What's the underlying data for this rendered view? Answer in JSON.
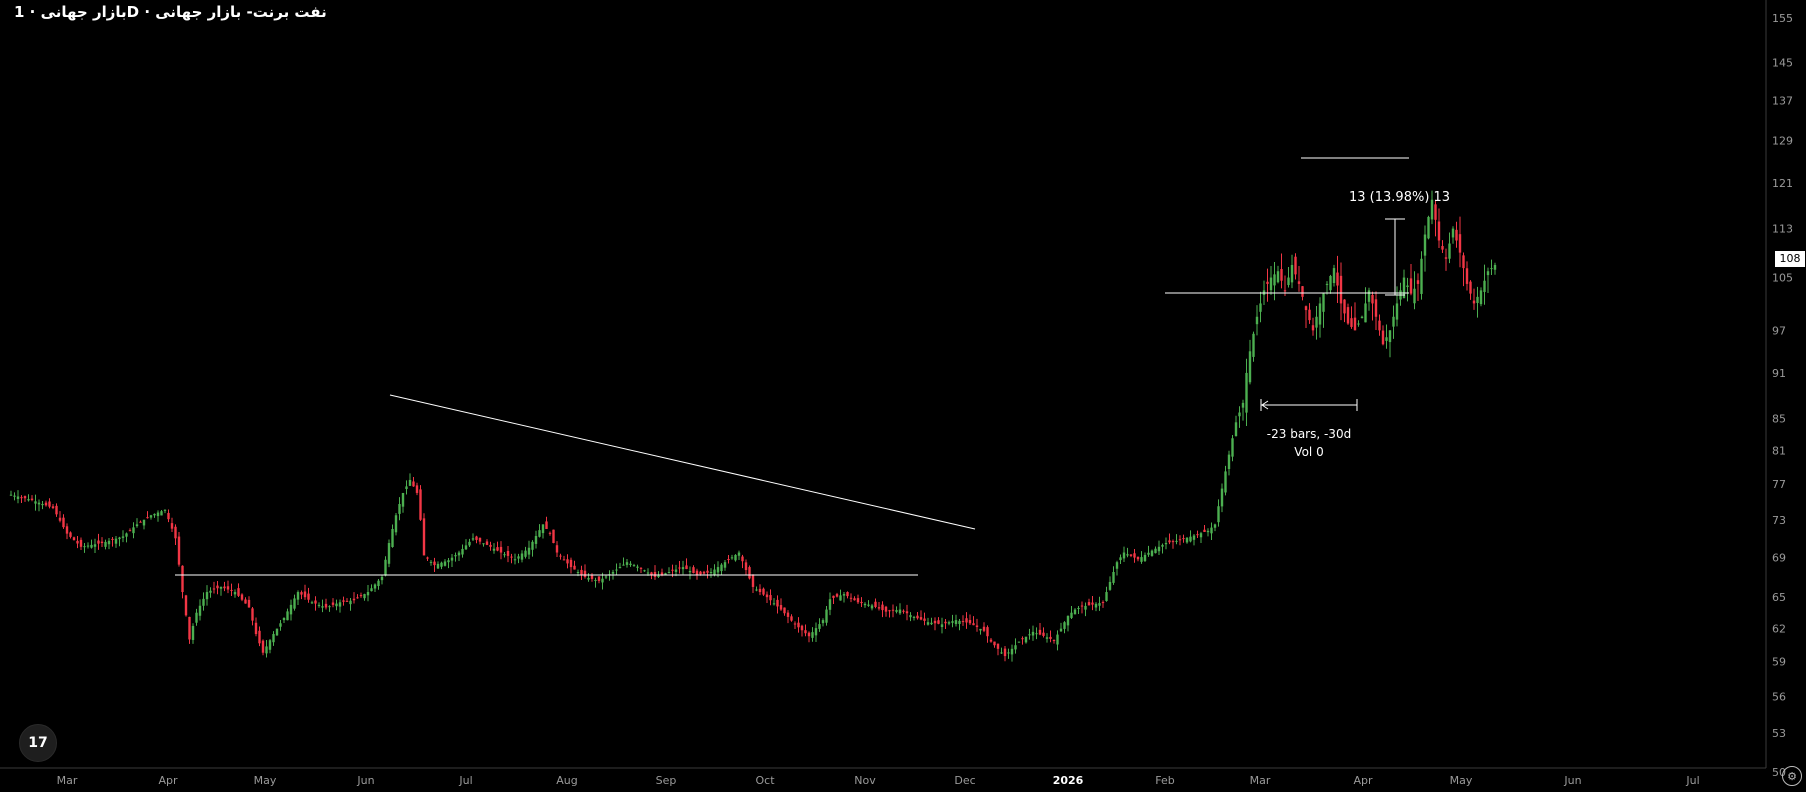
{
  "title": "بازار جهانی · 1D · نفت برنت- بازار جهانی",
  "logo_text": "17",
  "settings_icon": "gear-icon",
  "colors": {
    "up": "#4caf50",
    "down": "#f23645",
    "line": "#ffffff",
    "axis": "#9a9a9a"
  },
  "price_label": "108",
  "chart_data": {
    "type": "candlestick",
    "y_scale": "log",
    "ylim": [
      49.5,
      160
    ],
    "y_ticks": [
      "155",
      "145",
      "137",
      "129",
      "121",
      "113",
      "105",
      "97",
      "91",
      "85",
      "81",
      "77",
      "73",
      "69",
      "65",
      "62",
      "59",
      "56",
      "53",
      "50"
    ],
    "x_ticks": [
      "Mar",
      "Apr",
      "May",
      "Jun",
      "Jul",
      "Aug",
      "Sep",
      "Oct",
      "Nov",
      "Dec",
      "2026",
      "Feb",
      "Mar",
      "Apr",
      "May",
      "Jun",
      "Jul"
    ],
    "price_path": [
      [
        0,
        75.8
      ],
      [
        6,
        75.2
      ],
      [
        12,
        74.3
      ],
      [
        16,
        71.5
      ],
      [
        20,
        70.1
      ],
      [
        26,
        70.5
      ],
      [
        32,
        71.2
      ],
      [
        36,
        72.5
      ],
      [
        40,
        73.5
      ],
      [
        44,
        74.1
      ],
      [
        47,
        71
      ],
      [
        49,
        65.5
      ],
      [
        51,
        61
      ],
      [
        53,
        63.5
      ],
      [
        56,
        65.5
      ],
      [
        60,
        66
      ],
      [
        64,
        65.5
      ],
      [
        68,
        64
      ],
      [
        70,
        61.5
      ],
      [
        72,
        59.8
      ],
      [
        75,
        61.5
      ],
      [
        78,
        63
      ],
      [
        82,
        65.5
      ],
      [
        86,
        64.5
      ],
      [
        90,
        64
      ],
      [
        94,
        64.5
      ],
      [
        98,
        64.7
      ],
      [
        102,
        65.5
      ],
      [
        106,
        67
      ],
      [
        108,
        70.5
      ],
      [
        110,
        73.5
      ],
      [
        112,
        76
      ],
      [
        114,
        77.5
      ],
      [
        116,
        76
      ],
      [
        117,
        73
      ],
      [
        118,
        69.2
      ],
      [
        121,
        68.2
      ],
      [
        125,
        68.7
      ],
      [
        128,
        69.5
      ],
      [
        132,
        71
      ],
      [
        136,
        70.3
      ],
      [
        140,
        69.5
      ],
      [
        144,
        68.8
      ],
      [
        148,
        70
      ],
      [
        152,
        72.5
      ],
      [
        154,
        71.5
      ],
      [
        156,
        69.5
      ],
      [
        160,
        68
      ],
      [
        164,
        67
      ],
      [
        168,
        66.6
      ],
      [
        172,
        67.5
      ],
      [
        176,
        68.5
      ],
      [
        180,
        67.9
      ],
      [
        184,
        67
      ],
      [
        188,
        67.5
      ],
      [
        192,
        68
      ],
      [
        196,
        67.2
      ],
      [
        200,
        67.5
      ],
      [
        204,
        68.5
      ],
      [
        208,
        69.5
      ],
      [
        210,
        67.7
      ],
      [
        212,
        66
      ],
      [
        216,
        65
      ],
      [
        220,
        63.8
      ],
      [
        224,
        62.4
      ],
      [
        228,
        61.3
      ],
      [
        232,
        62.8
      ],
      [
        234,
        64.8
      ],
      [
        238,
        65.3
      ],
      [
        242,
        64.5
      ],
      [
        246,
        64.2
      ],
      [
        250,
        63.6
      ],
      [
        254,
        63.8
      ],
      [
        258,
        63.1
      ],
      [
        262,
        62.6
      ],
      [
        266,
        62.4
      ],
      [
        270,
        62.8
      ],
      [
        274,
        62.5
      ],
      [
        278,
        61.8
      ],
      [
        280,
        60.8
      ],
      [
        284,
        59.5
      ],
      [
        288,
        60.8
      ],
      [
        292,
        61.7
      ],
      [
        296,
        61.2
      ],
      [
        298,
        60.9
      ],
      [
        300,
        62
      ],
      [
        302,
        63.2
      ],
      [
        304,
        63.8
      ],
      [
        306,
        64.1
      ],
      [
        308,
        64.2
      ],
      [
        312,
        64.5
      ],
      [
        314,
        66.5
      ],
      [
        316,
        68.5
      ],
      [
        318,
        69.5
      ],
      [
        322,
        68.8
      ],
      [
        326,
        69.7
      ],
      [
        330,
        70.5
      ],
      [
        334,
        70.8
      ],
      [
        338,
        71.3
      ],
      [
        342,
        71.8
      ],
      [
        344,
        72.5
      ],
      [
        346,
        76.5
      ],
      [
        348,
        80.5
      ],
      [
        350,
        84.5
      ],
      [
        352,
        87
      ],
      [
        353,
        91
      ],
      [
        354,
        94
      ],
      [
        356,
        99
      ],
      [
        358,
        103
      ],
      [
        360,
        105
      ],
      [
        362,
        106
      ],
      [
        364,
        103
      ],
      [
        366,
        107
      ],
      [
        368,
        104
      ],
      [
        370,
        100
      ],
      [
        372,
        97
      ],
      [
        374,
        101
      ],
      [
        376,
        104
      ],
      [
        378,
        106.5
      ],
      [
        380,
        101
      ],
      [
        382,
        98
      ],
      [
        384,
        97
      ],
      [
        386,
        99
      ],
      [
        388,
        103
      ],
      [
        390,
        99
      ],
      [
        392,
        95
      ],
      [
        394,
        97
      ],
      [
        396,
        101
      ],
      [
        398,
        105
      ],
      [
        400,
        102.5
      ],
      [
        402,
        104
      ],
      [
        404,
        112
      ],
      [
        406,
        118
      ],
      [
        408,
        111
      ],
      [
        410,
        108
      ],
      [
        412,
        113
      ],
      [
        414,
        109
      ],
      [
        416,
        104
      ],
      [
        418,
        101
      ],
      [
        420,
        103
      ],
      [
        422,
        106
      ],
      [
        424,
        107
      ]
    ],
    "annotations": {
      "measure_label": "13 (13.98%) 13",
      "range_label": "-23 bars, -30d",
      "volume_label": "Vol 0"
    }
  }
}
